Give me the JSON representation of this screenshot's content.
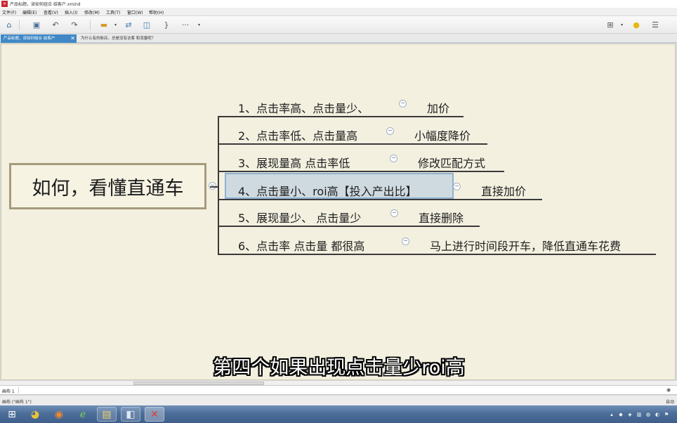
{
  "window": {
    "title": "产品标题，读如何组合 结客户.xmind",
    "app_icon": "xmind-icon"
  },
  "menu": [
    "文件(F)",
    "编辑(E)",
    "查看(V)",
    "插入(I)",
    "修改(M)",
    "工具(T)",
    "窗口(W)",
    "帮助(H)"
  ],
  "toolbar": {
    "more_label": "···",
    "icons": [
      "home-icon",
      "save-icon",
      "undo-icon",
      "redo-icon",
      "topic-icon",
      "relationship-icon",
      "boundary-icon",
      "summary-icon",
      "more-icon",
      "structure-icon",
      "idea-icon",
      "outline-icon"
    ]
  },
  "tabs": {
    "active": "产品标题，读如何组合 结客户",
    "inactive": "为什么有的新店，总是没有访客 和流量呢？"
  },
  "mindmap": {
    "central_topic": "如何，看懂直通车",
    "collapse_symbol": "−",
    "branches": [
      {
        "label": "1、点击率高、点击量少、",
        "child": "加价"
      },
      {
        "label": "2、点击率低、点击量高",
        "child": "小幅度降价"
      },
      {
        "label": "3、展现量高    点击率低",
        "child": "修改匹配方式"
      },
      {
        "label": "4、点击量小、roi高【投入产出比】",
        "child": "直接加价"
      },
      {
        "label": "5、展现量少、 点击量少",
        "child": "直接删除"
      },
      {
        "label": "6、点击率  点击量  都很高",
        "child": "马上进行时间段开车，降低直通车花费"
      }
    ]
  },
  "subtitle": "第四个如果出现点击量少roi高",
  "sheet_bar": {
    "sheet_name": "画布 1"
  },
  "status_bar": {
    "left": "画布 (\"画布 1\")",
    "right": "自动"
  },
  "taskbar": {
    "icons": [
      "windows-start-icon",
      "chrome-icon",
      "firefox-icon",
      "ie-icon",
      "notepad-icon",
      "window-manager-icon",
      "xmind-taskbar-icon"
    ]
  },
  "colors": {
    "canvas_bg": "#f3f0e0",
    "central_border": "#a79b7d",
    "selection": "#8fb0d1",
    "tab_active": "#3f88c5"
  }
}
